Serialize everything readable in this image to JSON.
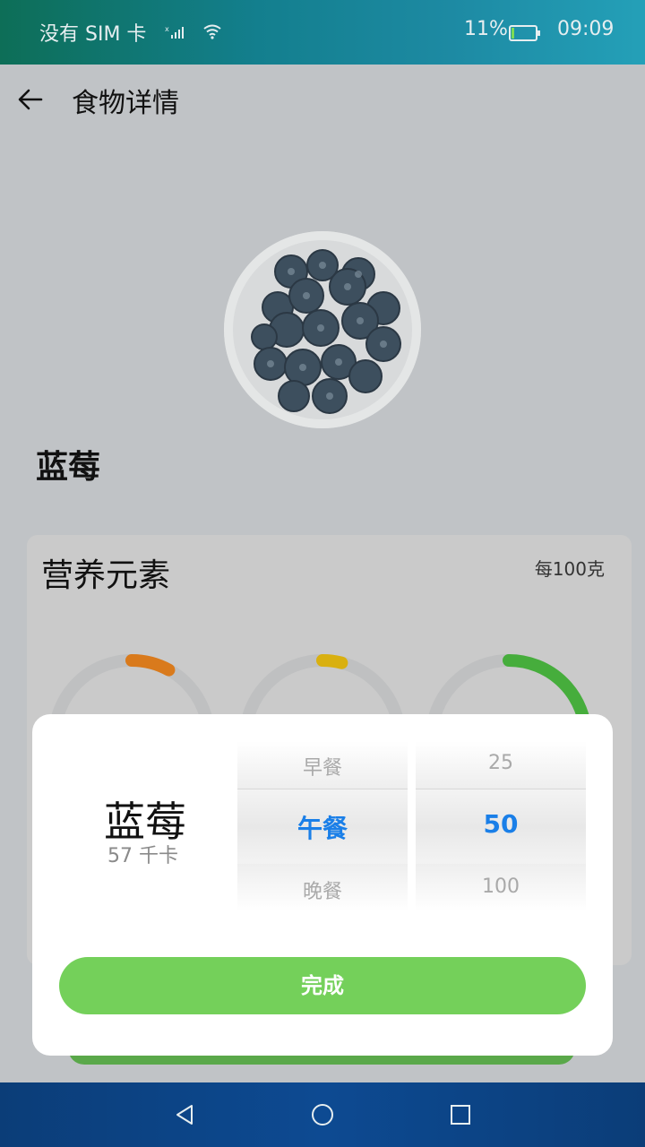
{
  "status_bar": {
    "carrier": "没有 SIM 卡",
    "battery_percent": "11%",
    "battery_level": 0.11,
    "time": "09:09",
    "icons": [
      "signal-icon",
      "wifi-icon",
      "battery-icon"
    ]
  },
  "header": {
    "title": "食物详情",
    "back_icon": "back-arrow-icon"
  },
  "food": {
    "name": "蓝莓",
    "image": "blueberries-bowl-image"
  },
  "nutrition_card": {
    "title": "营养元素",
    "per_unit": "每100克",
    "rings": [
      {
        "color": "#d97a1c",
        "level": 0.08
      },
      {
        "color": "#d9b010",
        "level": 0.04
      },
      {
        "color": "#46ad3c",
        "level": 0.55
      }
    ]
  },
  "dialog": {
    "food_name": "蓝莓",
    "calories": "57 千卡",
    "meal_picker": {
      "prev": "早餐",
      "selected": "午餐",
      "next": "晚餐"
    },
    "amount_picker": {
      "prev": "25",
      "selected": "50",
      "next": "100"
    },
    "done_label": "完成",
    "colors": {
      "accent": "#1a7fe8",
      "button": "#74d05a"
    }
  },
  "nav_bar": {
    "icons": [
      "back-triangle-icon",
      "home-circle-icon",
      "recents-square-icon"
    ]
  }
}
